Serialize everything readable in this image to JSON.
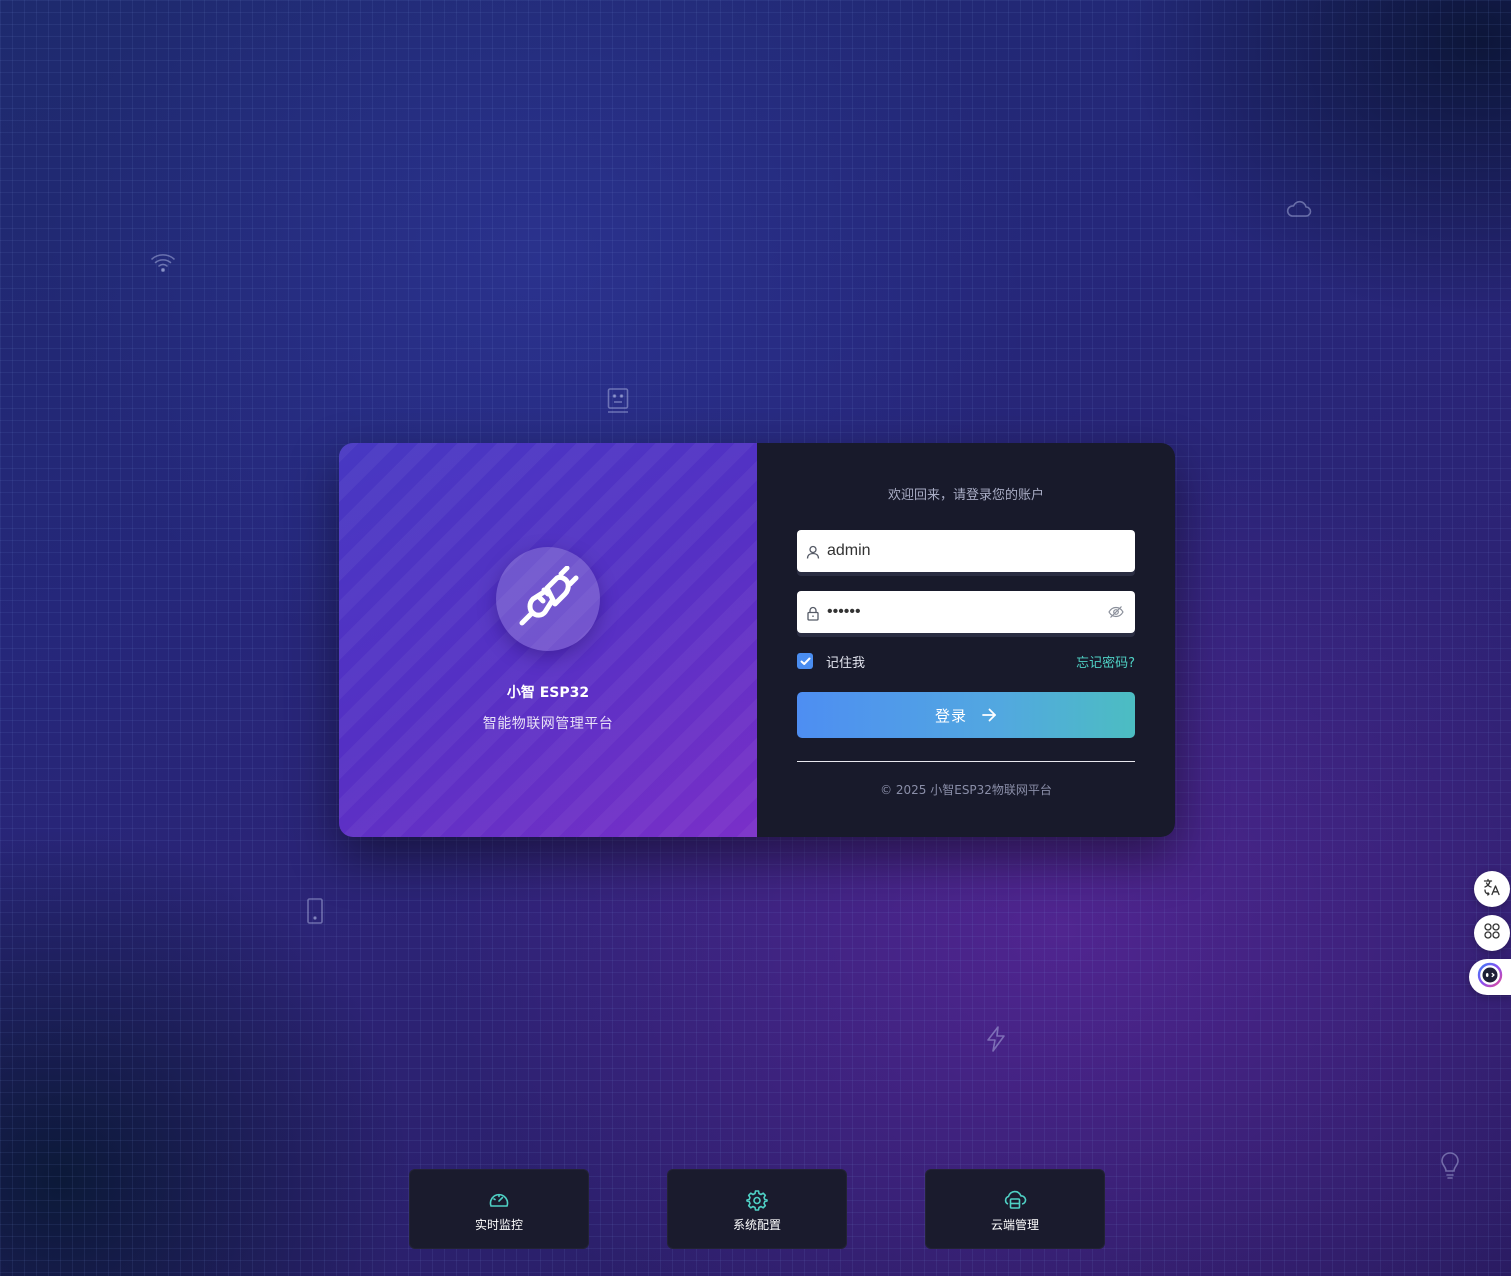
{
  "brand": {
    "title": "小智 ESP32",
    "subtitle": "智能物联网管理平台"
  },
  "login": {
    "welcome": "欢迎回来，请登录您的账户",
    "username_value": "admin",
    "password_value": "••••••",
    "remember_label": "记住我",
    "remember_checked": true,
    "forgot_label": "忘记密码?",
    "submit_label": "登录",
    "copyright": "© 2025 小智ESP32物联网平台"
  },
  "features": [
    {
      "label": "实时监控",
      "icon": "dashboard-gauge-icon"
    },
    {
      "label": "系统配置",
      "icon": "gear-icon"
    },
    {
      "label": "云端管理",
      "icon": "cloud-server-icon"
    }
  ],
  "side_tools": [
    {
      "icon": "translate-icon"
    },
    {
      "icon": "apps-grid-icon"
    },
    {
      "icon": "assistant-face-icon"
    }
  ],
  "background_icons": [
    "wifi-icon",
    "robot-icon",
    "cloud-icon",
    "phone-icon",
    "lightning-icon",
    "lightbulb-icon"
  ],
  "colors": {
    "accent_teal": "#4fd1c5",
    "checkbox_blue": "#4a8df0",
    "button_gradient_start": "#4e8ef2",
    "button_gradient_end": "#4cbdc2",
    "panel_dark": "#181a2b",
    "brand_purple": "#5530c4"
  }
}
